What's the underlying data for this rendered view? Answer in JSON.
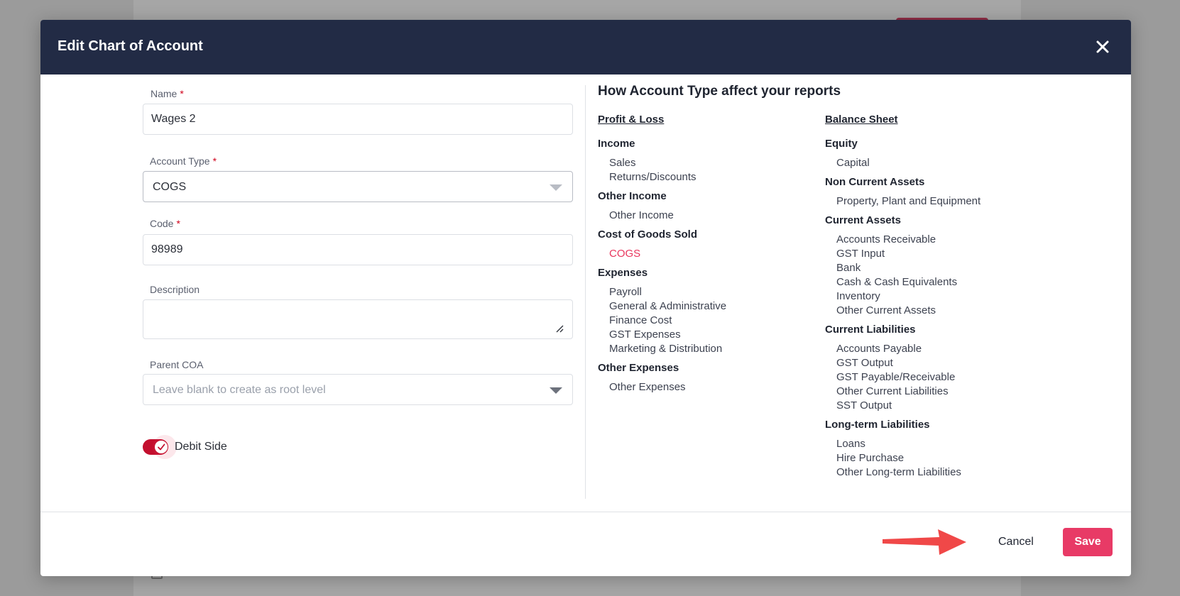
{
  "modal": {
    "title": "Edit Chart of Account"
  },
  "form": {
    "name": {
      "label": "Name",
      "required_mark": "*",
      "value": "Wages 2"
    },
    "account_type": {
      "label": "Account Type",
      "required_mark": "*",
      "value": "COGS"
    },
    "code": {
      "label": "Code",
      "required_mark": "*",
      "value": "98989"
    },
    "description": {
      "label": "Description",
      "value": ""
    },
    "parent_coa": {
      "label": "Parent COA",
      "placeholder": "Leave blank to create as root level"
    },
    "debit_side": {
      "label": "Debit Side",
      "checked": true
    }
  },
  "info": {
    "title": "How Account Type affect your reports",
    "profit_loss": {
      "heading": "Profit & Loss",
      "groups": [
        {
          "title": "Income",
          "items": [
            "Sales",
            "Returns/Discounts"
          ]
        },
        {
          "title": "Other Income",
          "items": [
            "Other Income"
          ]
        },
        {
          "title": "Cost of Goods Sold",
          "items": [
            "COGS"
          ]
        },
        {
          "title": "Expenses",
          "items": [
            "Payroll",
            "General & Administrative",
            "Finance Cost",
            "GST Expenses",
            "Marketing & Distribution"
          ]
        },
        {
          "title": "Other Expenses",
          "items": [
            "Other Expenses"
          ]
        }
      ]
    },
    "balance_sheet": {
      "heading": "Balance Sheet",
      "groups": [
        {
          "title": "Equity",
          "items": [
            "Capital"
          ]
        },
        {
          "title": "Non Current Assets",
          "items": [
            "Property, Plant and Equipment"
          ]
        },
        {
          "title": "Current Assets",
          "items": [
            "Accounts Receivable",
            "GST Input",
            "Bank",
            "Cash & Cash Equivalents",
            "Inventory",
            "Other Current Assets"
          ]
        },
        {
          "title": "Current Liabilities",
          "items": [
            "Accounts Payable",
            "GST Output",
            "GST Payable/Receivable",
            "Other Current Liabilities",
            "SST Output"
          ]
        },
        {
          "title": "Long-term Liabilities",
          "items": [
            "Loans",
            "Hire Purchase",
            "Other Long-term Liabilities"
          ]
        }
      ]
    },
    "highlighted_item": "COGS"
  },
  "footer": {
    "cancel_label": "Cancel",
    "save_label": "Save"
  },
  "colors": {
    "header_bg": "#222b45",
    "accent": "#e83a66",
    "toggle_on": "#c30f2e",
    "required": "#d0021b",
    "arrow": "#f04848"
  },
  "icons": {
    "close": "close-icon",
    "dropdown": "chevron-down-icon",
    "resize": "resize-handle-icon",
    "check": "check-icon",
    "annotation_arrow": "arrow-right-icon"
  }
}
